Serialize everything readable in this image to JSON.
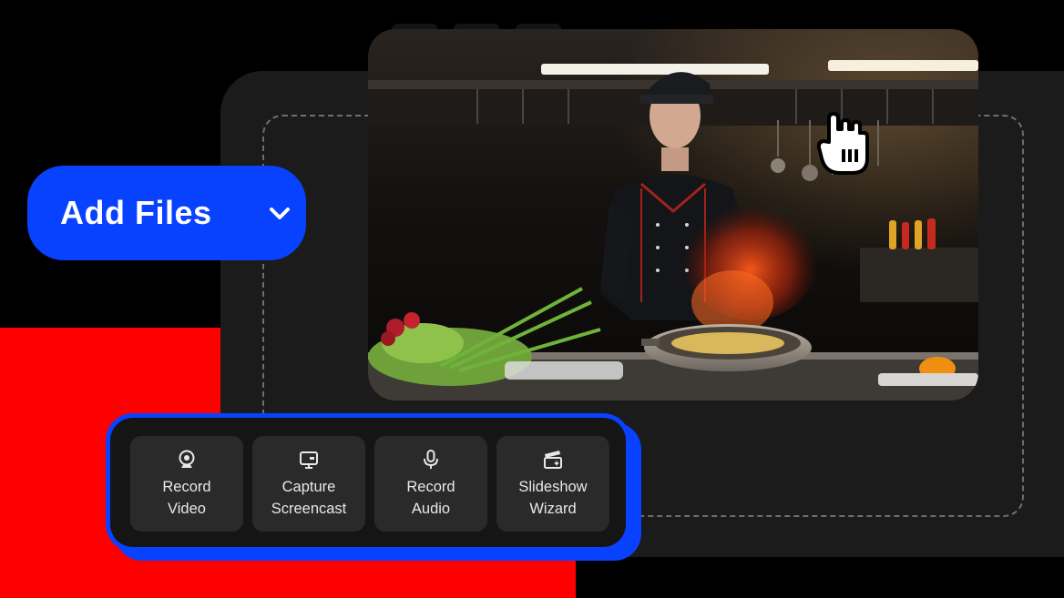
{
  "add_files": {
    "label": "Add Files",
    "icon": "chevron-down-icon",
    "color": "#0842ff"
  },
  "tools": [
    {
      "label": "Record\nVideo",
      "icon": "webcam-icon"
    },
    {
      "label": "Capture\nScreencast",
      "icon": "monitor-icon"
    },
    {
      "label": "Record\nAudio",
      "icon": "microphone-icon"
    },
    {
      "label": "Slideshow\nWizard",
      "icon": "clapperboard-icon"
    }
  ],
  "preview": {
    "icon": "hand-cursor-icon"
  },
  "colors": {
    "accent": "#0842ff",
    "red": "#ff0000",
    "panel": "#1b1b1b",
    "tray": "#151515",
    "tool_button": "#2a2a2a"
  }
}
